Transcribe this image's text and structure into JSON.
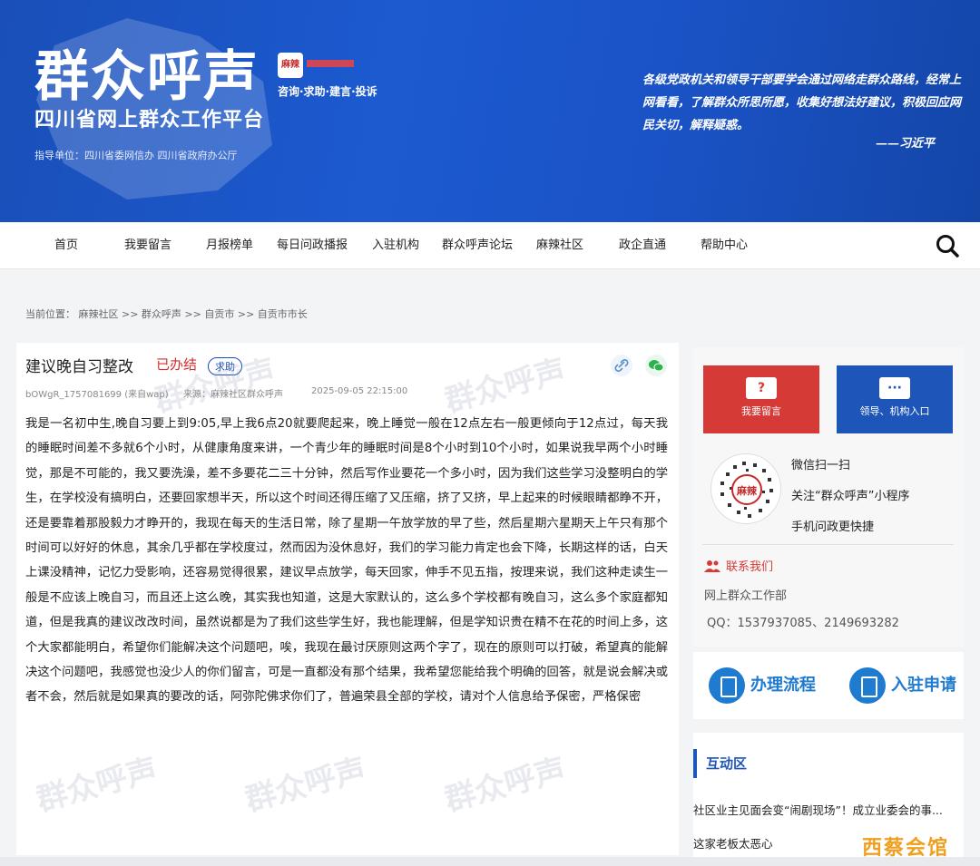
{
  "header": {
    "logo_main": "群众呼声",
    "logo_badge": "麻辣",
    "logo_slogan": "咨询·求助·建言·投诉",
    "logo_sub": "四川省网上群众工作平台",
    "guide": "指导单位：四川省委网信办  四川省政府办公厅",
    "quote": "各级党政机关和领导干部要学会通过网络走群众路线，经常上网看看，了解群众所思所愿，收集好想法好建议，积极回应网民关切，解释疑惑。",
    "quote_author": "——习近平"
  },
  "nav": {
    "items": [
      "首页",
      "我要留言",
      "月报榜单",
      "每日问政播报",
      "入驻机构",
      "群众呼声论坛",
      "麻辣社区",
      "政企直通",
      "帮助中心"
    ]
  },
  "breadcrumb": {
    "label": "当前位置：",
    "path": "麻辣社区 >> 群众呼声 >> 自贡市 >> 自贡市市长"
  },
  "article": {
    "title": "建议晚自习整改",
    "status": "已办结",
    "tag": "求助",
    "author": "bOWgR_1757081699 (来自wap)",
    "source": "来源：麻辣社区群众呼声",
    "time": "2025-09-05 22:15:00",
    "body": "我是一名初中生,晚自习要上到9:05,早上我6点20就要爬起来，晚上睡觉一般在12点左右一般更倾向于12点过，每天我的睡眠时间差不多就6个小时，从健康角度来讲，一个青少年的睡眠时间是8个小时到10个小时，如果说我早两个小时睡觉，那是不可能的，我又要洗澡，差不多要花二三十分钟，然后写作业要花一个多小时，因为我们这些学习没整明白的学生，在学校没有搞明白，还要回家想半天，所以这个时间还得压缩了又压缩，挤了又挤，早上起来的时候眼睛都睁不开，还是要靠着那股毅力才睁开的，我现在每天的生活日常，除了星期一午放学放的早了些，然后星期六星期天上午只有那个时间可以好好的休息，其余几乎都在学校度过，然而因为没休息好，我们的学习能力肯定也会下降，长期这样的话，白天上课没精神，记忆力受影响，还容易觉得很累，建议早点放学，每天回家，伸手不见五指，按理来说，我们这种走读生一般是不应该上晚自习，而且还上这么晚，其实我也知道，这是大家默认的，这么多个学校都有晚自习，这么多个家庭都知道，但是我真的建议改改时间，虽然说都是为了我们这些学生好，我也能理解，但是学知识贵在精不在花的时间上多，这个大家都能明白，希望你们能解决这个问题吧，唉，我现在最讨厌原则这两个字了，现在的原则可以打破，希望真的能解决这个问题吧，我感觉也没少人的你们留言，可是一直都没有那个结果，我希望您能给我个明确的回答，就是说会解决或者不会，然后就是如果真的要改的话，阿弥陀佛求你们了，普遍荣县全部的学校，请对个人信息给予保密，严格保密",
    "watermark": "群众呼声"
  },
  "sidebar": {
    "btn_leave_msg": "我要留言",
    "btn_leave_icon": "?",
    "btn_entry": "领导、机构入口",
    "btn_entry_icon": "···",
    "qr_badge": "麻辣",
    "mini_lines": [
      "微信扫一扫",
      "关注“群众呼声”小程序",
      "手机问政更快捷"
    ],
    "contact_title": "联系我们",
    "contact_org": "网上群众工作部",
    "contact_qq": "QQ：1537937085、2149693282",
    "banner_items": [
      "办理流程",
      "入驻申请"
    ],
    "interact_title": "互动区",
    "news": [
      "社区业主见面会变“闹剧现场”！成立业委会的事...",
      "这家老板太恶心"
    ]
  },
  "brand": "西蔡会馆",
  "colors": {
    "header_blue": "#1a52c4",
    "status_red": "#d32f2f",
    "accent_blue": "#1e55b8",
    "brand_orange": "#f0a020"
  }
}
